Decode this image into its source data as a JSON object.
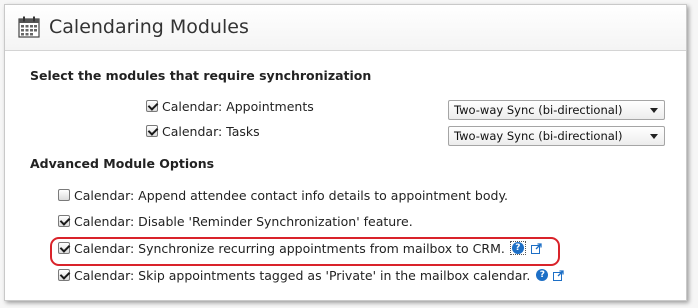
{
  "header": {
    "title": "Calendaring Modules",
    "icon": "calendar-icon"
  },
  "sync_section": {
    "heading": "Select the modules that require synchronization",
    "modules": [
      {
        "label": "Calendar: Appointments",
        "checked": true,
        "sync_mode": "Two-way Sync (bi-directional)"
      },
      {
        "label": "Calendar: Tasks",
        "checked": true,
        "sync_mode": "Two-way Sync (bi-directional)"
      }
    ]
  },
  "advanced_section": {
    "heading": "Advanced Module Options",
    "options": [
      {
        "label": "Calendar: Append attendee contact info details to appointment body.",
        "checked": false
      },
      {
        "label": "Calendar: Disable 'Reminder Synchronization' feature.",
        "checked": true
      },
      {
        "label": "Calendar: Synchronize recurring appointments from mailbox to CRM.",
        "checked": true,
        "help_icon": "help-icon",
        "link_icon": "external-link-icon",
        "highlighted": true
      },
      {
        "label": "Calendar: Skip appointments tagged as 'Private' in the mailbox calendar.",
        "checked": true,
        "help_icon": "help-icon",
        "link_icon": "external-link-icon"
      }
    ]
  },
  "colors": {
    "highlight": "#d9232a",
    "help_icon": "#1d6fc6"
  }
}
